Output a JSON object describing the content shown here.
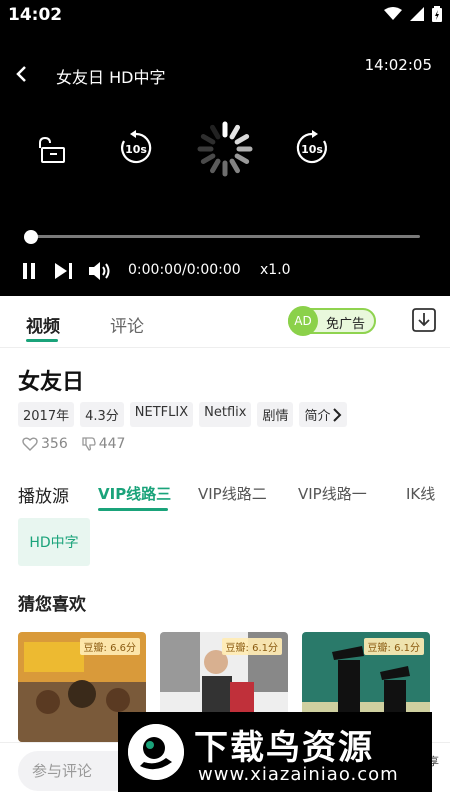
{
  "status_bar": {
    "time": "14:02",
    "icons": [
      "wifi-icon",
      "signal-icon",
      "battery-icon"
    ]
  },
  "player": {
    "title": "女友日 HD中字",
    "clock": "14:02:05",
    "time_current": "0:00:00",
    "time_separator": "/",
    "time_total": "0:00:00",
    "speed": "x1.0",
    "progress": 0,
    "icons": {
      "back": "back-arrow-icon",
      "lock": "unlock-icon",
      "rewind": "rewind-10s-icon",
      "forward": "forward-10s-icon",
      "loading": "loading-spinner-icon",
      "pause": "pause-icon",
      "next": "next-icon",
      "volume": "volume-icon"
    },
    "rewind_label": "10s",
    "forward_label": "10s"
  },
  "tabs": [
    {
      "label": "视频",
      "active": true
    },
    {
      "label": "评论",
      "active": false
    }
  ],
  "ad_badge": {
    "circle": "AD",
    "label": "免广告"
  },
  "movie": {
    "title": "女友日",
    "tags": [
      "2017年",
      "4.3分",
      "NETFLIX",
      "Netflix",
      "剧情"
    ],
    "intro_label": "简介",
    "likes": "356",
    "dislikes": "447"
  },
  "sources": {
    "label": "播放源",
    "items": [
      "VIP线路三",
      "VIP线路二",
      "VIP线路一",
      "IK线"
    ],
    "active_index": 0
  },
  "episode": "HD中字",
  "recommend": {
    "title": "猜您喜欢",
    "cards": [
      {
        "rating": "豆瓣: 6.6分"
      },
      {
        "rating": "豆瓣: 6.1分"
      },
      {
        "rating": "豆瓣: 6.1分"
      }
    ]
  },
  "comment": {
    "placeholder": "参与评论",
    "edge_label": "享"
  },
  "watermark": {
    "title": "下载鸟资源",
    "url": "www.xiazainiao.com"
  },
  "colors": {
    "accent": "#1aa37a",
    "player_bg": "#000000",
    "ad_green": "#8bd14a"
  }
}
